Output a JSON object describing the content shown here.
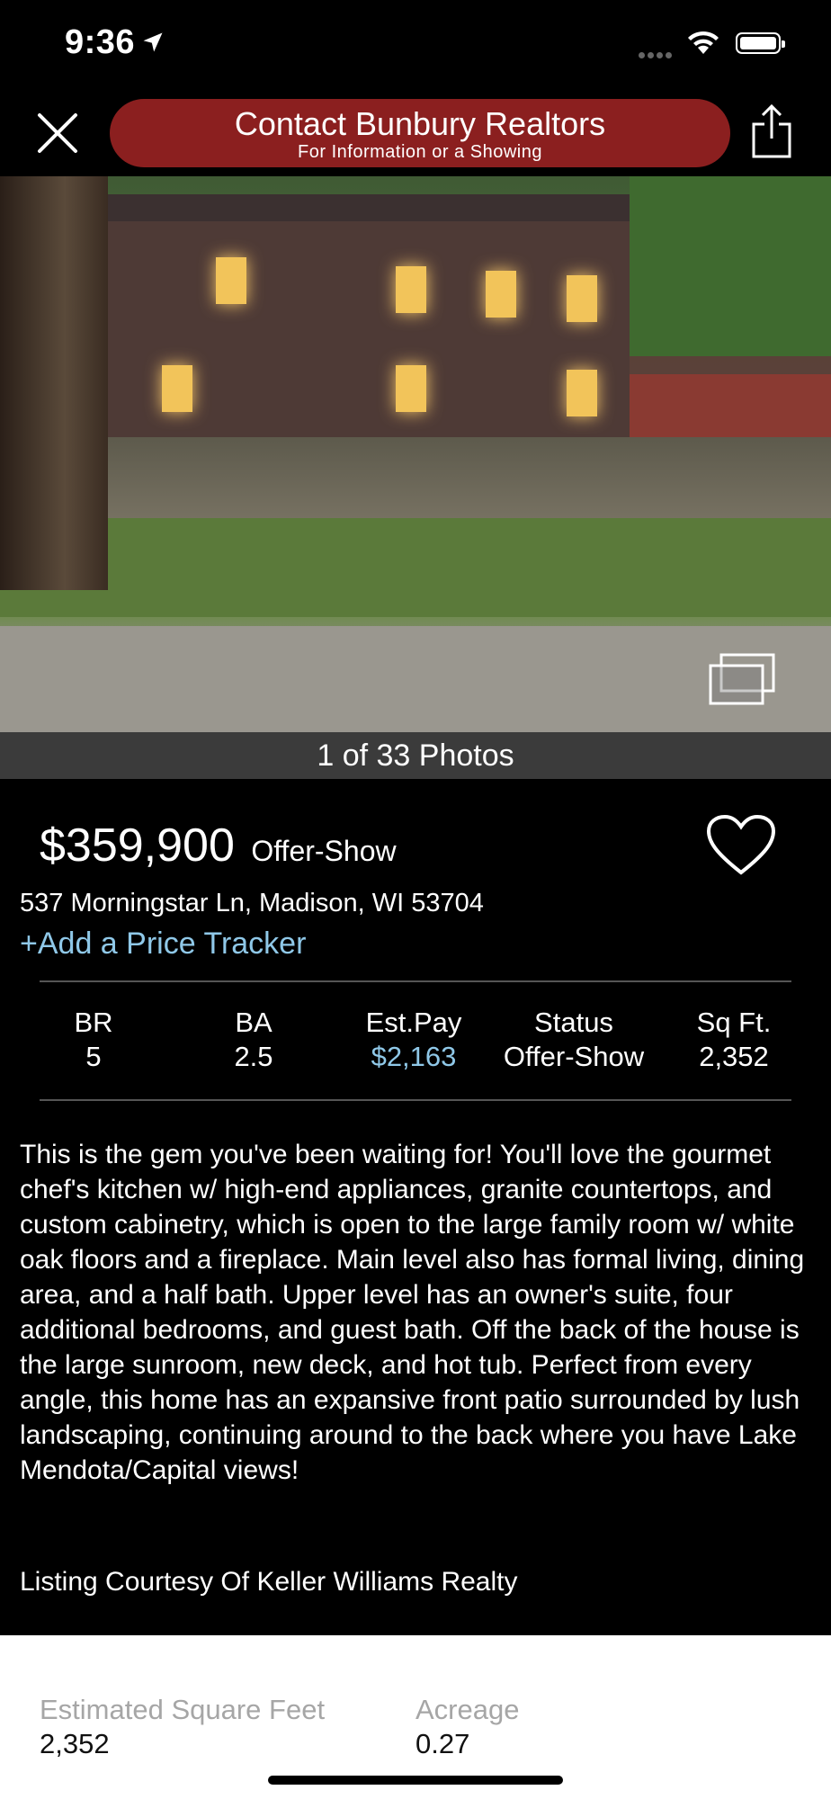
{
  "status_bar": {
    "time": "9:36"
  },
  "nav": {
    "contact_title": "Contact Bunbury Realtors",
    "contact_subtitle": "For Information or a Showing",
    "accent_color": "#8b1f1f"
  },
  "photo": {
    "counter": "1 of 33 Photos"
  },
  "listing": {
    "price": "$359,900",
    "status": "Offer-Show",
    "address": "537 Morningstar Ln, Madison, WI 53704",
    "price_tracker_link": "+Add a Price Tracker",
    "link_color": "#8fc8e8"
  },
  "stats": [
    {
      "label": "BR",
      "value": "5"
    },
    {
      "label": "BA",
      "value": "2.5"
    },
    {
      "label": "Est.Pay",
      "value": "$2,163"
    },
    {
      "label": "Status",
      "value": "Offer-Show"
    },
    {
      "label": "Sq Ft.",
      "value": "2,352"
    }
  ],
  "description": "This is the gem you've been waiting for!  You'll love the gourmet chef's kitchen w/ high-end appliances, granite countertops, and custom cabinetry, which is open to the large family room w/ white oak floors and a fireplace. Main level also has formal living, dining area, and a half bath. Upper level has an owner's suite, four additional bedrooms, and guest bath. Off the back of the house is the large sunroom, new deck, and hot tub. Perfect from every angle, this home has an expansive front patio surrounded by lush landscaping, continuing around to the back where you have Lake Mendota/Capital views!",
  "courtesy": "Listing Courtesy Of Keller Williams Realty",
  "details": [
    {
      "label": "Estimated Square Feet",
      "value": "2,352"
    },
    {
      "label": "Acreage",
      "value": "0.27"
    }
  ],
  "icons": [
    "location-arrow-icon",
    "wifi-icon",
    "battery-icon",
    "close-icon",
    "share-icon",
    "gallery-icon",
    "heart-icon"
  ]
}
